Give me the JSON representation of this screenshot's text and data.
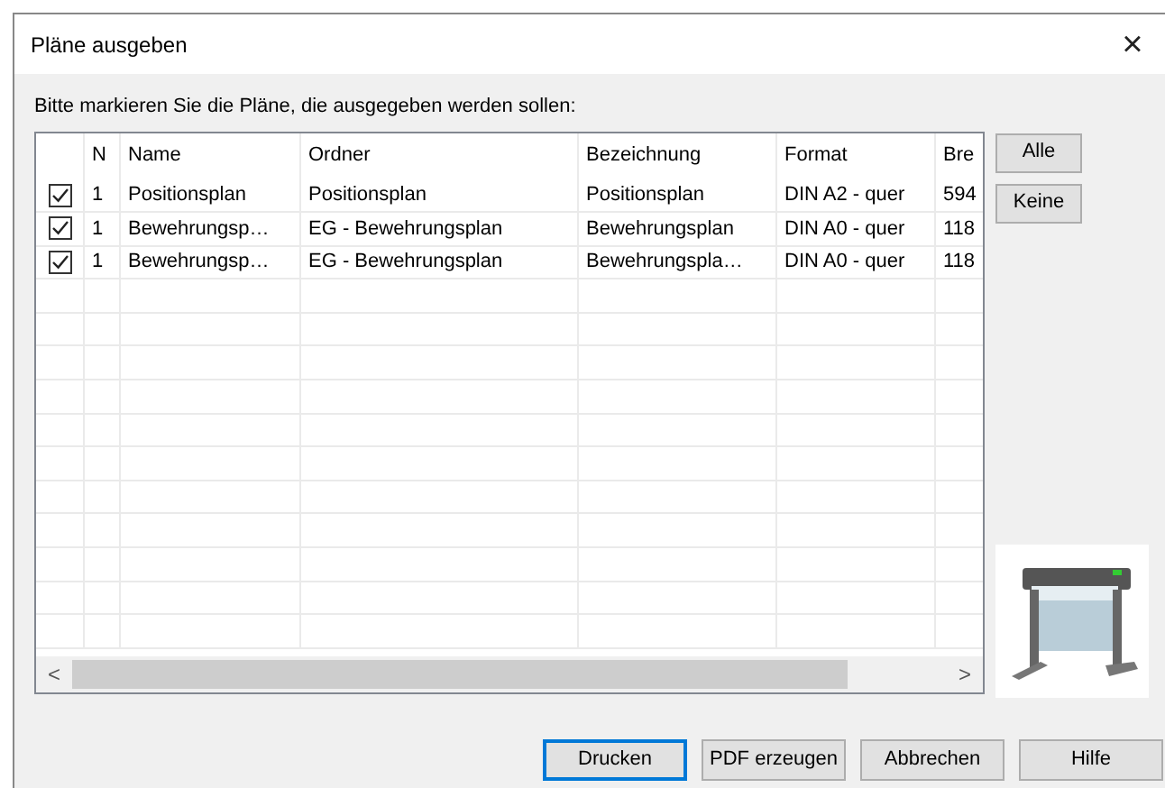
{
  "window": {
    "title": "Pläne ausgeben",
    "close": "×"
  },
  "instruction": "Bitte markieren Sie die Pläne, die ausgegeben werden sollen:",
  "table": {
    "columns": [
      "N",
      "Name",
      "Ordner",
      "Bezeichnung",
      "Format",
      "Bre"
    ],
    "rows": [
      {
        "checked": true,
        "cells": [
          "1",
          "Positionsplan",
          "Positionsplan",
          "Positionsplan",
          "DIN A2 - quer",
          "594"
        ]
      },
      {
        "checked": true,
        "cells": [
          "1",
          "Bewehrungsp…",
          "EG - Bewehrungsplan",
          "Bewehrungsplan",
          "DIN A0 - quer",
          "118"
        ]
      },
      {
        "checked": true,
        "cells": [
          "1",
          "Bewehrungsp…",
          "EG - Bewehrungsplan",
          "Bewehrungspla…",
          "DIN A0 - quer",
          "118"
        ]
      }
    ],
    "scroll_left": "<",
    "scroll_right": ">"
  },
  "side_buttons": [
    "Alle",
    "Keine"
  ],
  "buttons": [
    {
      "label": "Drucken",
      "default": true
    },
    {
      "label": "PDF erzeugen",
      "default": false
    },
    {
      "label": "Abbrechen",
      "default": false
    },
    {
      "label": "Hilfe",
      "default": false
    }
  ]
}
